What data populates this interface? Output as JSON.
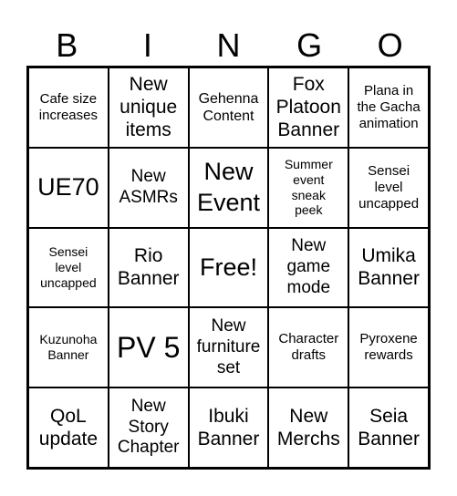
{
  "header": [
    "B",
    "I",
    "N",
    "G",
    "O"
  ],
  "cells": [
    {
      "text": "Cafe size\nincreases",
      "size": "s15"
    },
    {
      "text": "New\nunique\nitems",
      "size": "s20"
    },
    {
      "text": "Gehenna\nContent",
      "size": "s16"
    },
    {
      "text": "Fox\nPlatoon\nBanner",
      "size": "s20"
    },
    {
      "text": "Plana in\nthe Gacha\nanimation",
      "size": "s15"
    },
    {
      "text": "UE70",
      "size": "s27"
    },
    {
      "text": "New\nASMRs",
      "size": "s19"
    },
    {
      "text": "New\nEvent",
      "size": "s27"
    },
    {
      "text": "Summer\nevent\nsneak\npeek",
      "size": "s14"
    },
    {
      "text": "Sensei\nlevel\nuncapped",
      "size": "s15"
    },
    {
      "text": "Sensei\nlevel\nuncapped",
      "size": "s14"
    },
    {
      "text": "Rio\nBanner",
      "size": "s20"
    },
    {
      "text": "Free!",
      "size": "s27"
    },
    {
      "text": "New\ngame\nmode",
      "size": "s19"
    },
    {
      "text": "Umika\nBanner",
      "size": "s20"
    },
    {
      "text": "Kuzunoha\nBanner",
      "size": "s14"
    },
    {
      "text": "PV 5",
      "size": "s32"
    },
    {
      "text": "New\nfurniture\nset",
      "size": "s19"
    },
    {
      "text": "Character\ndrafts",
      "size": "s15"
    },
    {
      "text": "Pyroxene\nrewards",
      "size": "s15"
    },
    {
      "text": "QoL\nupdate",
      "size": "s20"
    },
    {
      "text": "New\nStory\nChapter",
      "size": "s19"
    },
    {
      "text": "Ibuki\nBanner",
      "size": "s20"
    },
    {
      "text": "New\nMerchs",
      "size": "s20"
    },
    {
      "text": "Seia\nBanner",
      "size": "s20"
    }
  ]
}
